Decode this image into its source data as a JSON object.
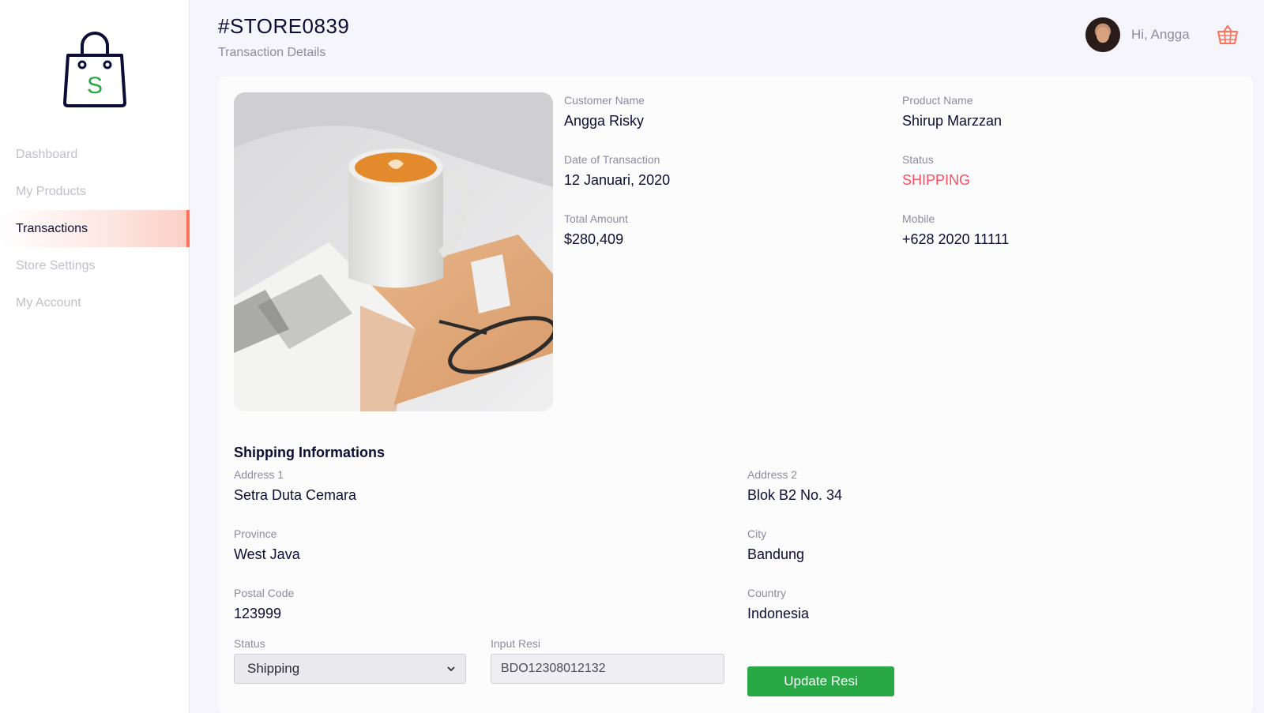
{
  "sidebar": {
    "logo_letter": "S",
    "items": [
      {
        "label": "Dashboard"
      },
      {
        "label": "My Products"
      },
      {
        "label": "Transactions"
      },
      {
        "label": "Store Settings"
      },
      {
        "label": "My Account"
      }
    ],
    "active_index": 2
  },
  "header": {
    "store_id": "#STORE0839",
    "subtitle": "Transaction Details",
    "greeting": "Hi, Angga"
  },
  "transaction": {
    "customer_name_label": "Customer Name",
    "customer_name": "Angga Risky",
    "product_name_label": "Product Name",
    "product_name": "Shirup Marzzan",
    "date_label": "Date of Transaction",
    "date": "12 Januari, 2020",
    "status_label": "Status",
    "status": "SHIPPING",
    "total_label": "Total Amount",
    "total": "$280,409",
    "mobile_label": "Mobile",
    "mobile": "+628 2020 11111"
  },
  "shipping": {
    "title": "Shipping Informations",
    "address1_label": "Address 1",
    "address1": "Setra Duta Cemara",
    "address2_label": "Address 2",
    "address2": "Blok B2 No. 34",
    "province_label": "Province",
    "province": "West Java",
    "city_label": "City",
    "city": "Bandung",
    "postal_label": "Postal Code",
    "postal": "123999",
    "country_label": "Country",
    "country": "Indonesia"
  },
  "form": {
    "status_label": "Status",
    "status_value": "Shipping",
    "resi_label": "Input Resi",
    "resi_value": "BDO12308012132",
    "button_label": "Update Resi"
  },
  "colors": {
    "accent": "#ff7158",
    "status_shipping": "#ff4d5f",
    "button": "#29a846",
    "logo_letter": "#29a846"
  }
}
